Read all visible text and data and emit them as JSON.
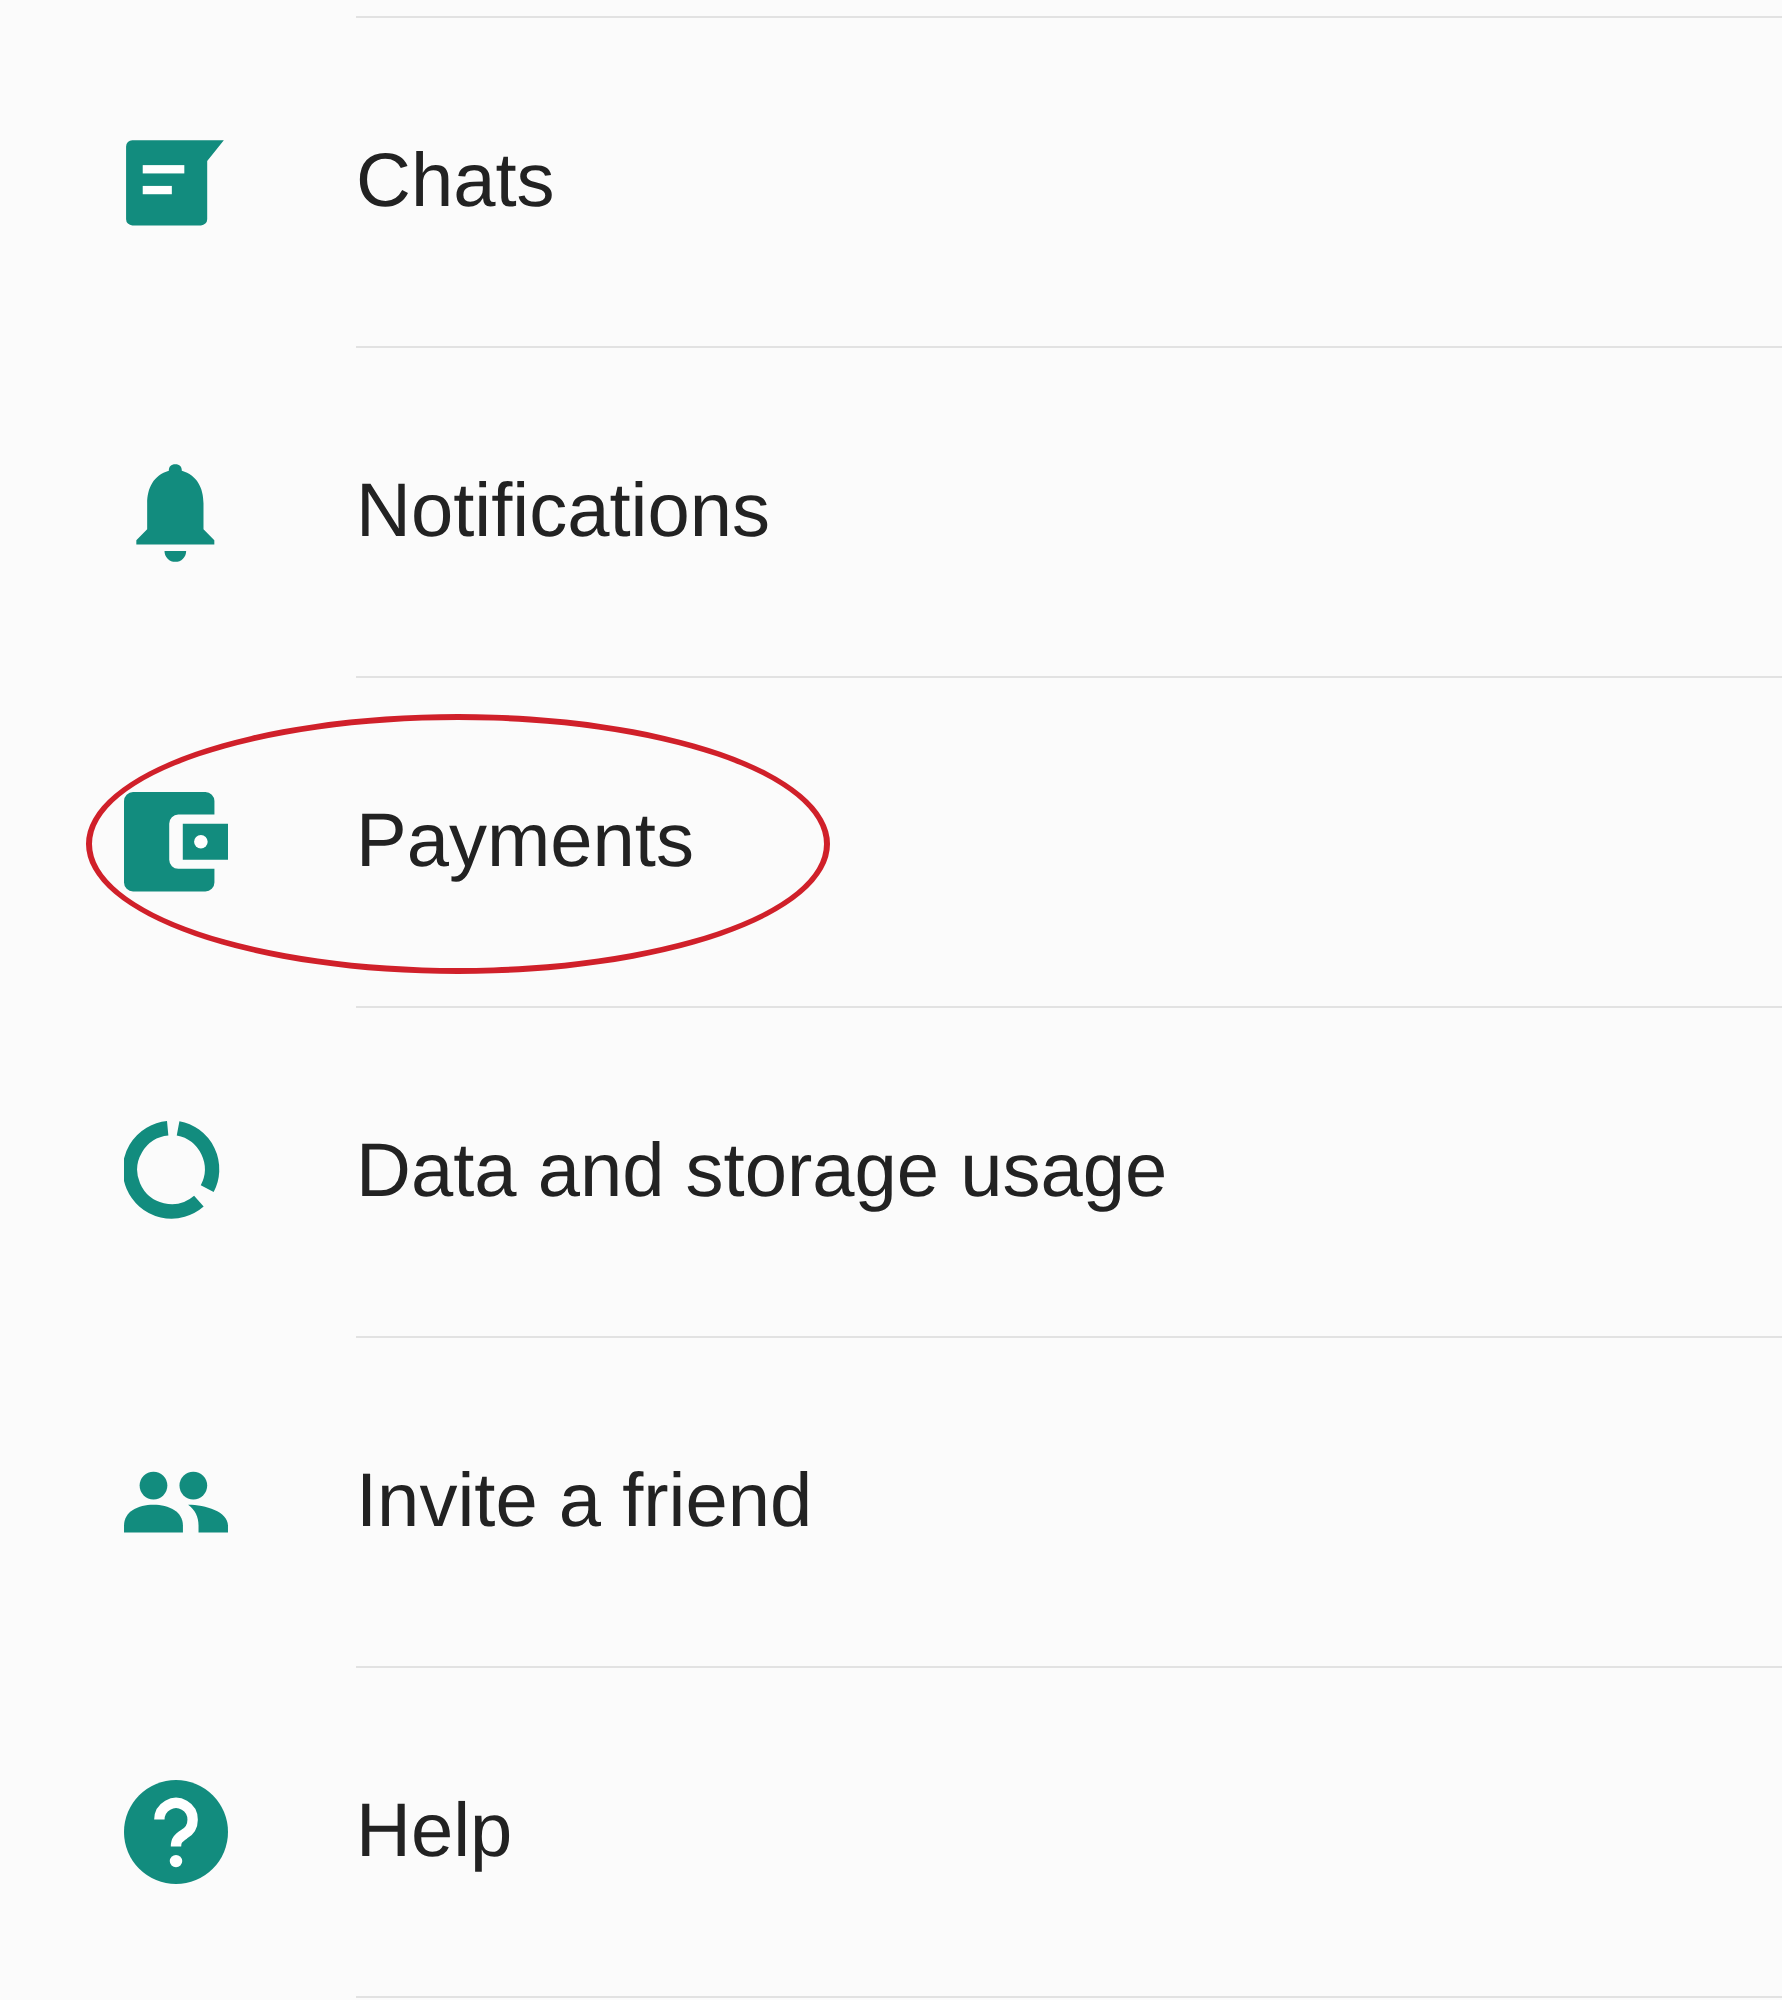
{
  "settings_items": [
    {
      "label": "Chats",
      "highlighted": false
    },
    {
      "label": "Notifications",
      "highlighted": false
    },
    {
      "label": "Payments",
      "highlighted": true
    },
    {
      "label": "Data and storage usage",
      "highlighted": false
    },
    {
      "label": "Invite a friend",
      "highlighted": false
    },
    {
      "label": "Help",
      "highlighted": false
    }
  ]
}
